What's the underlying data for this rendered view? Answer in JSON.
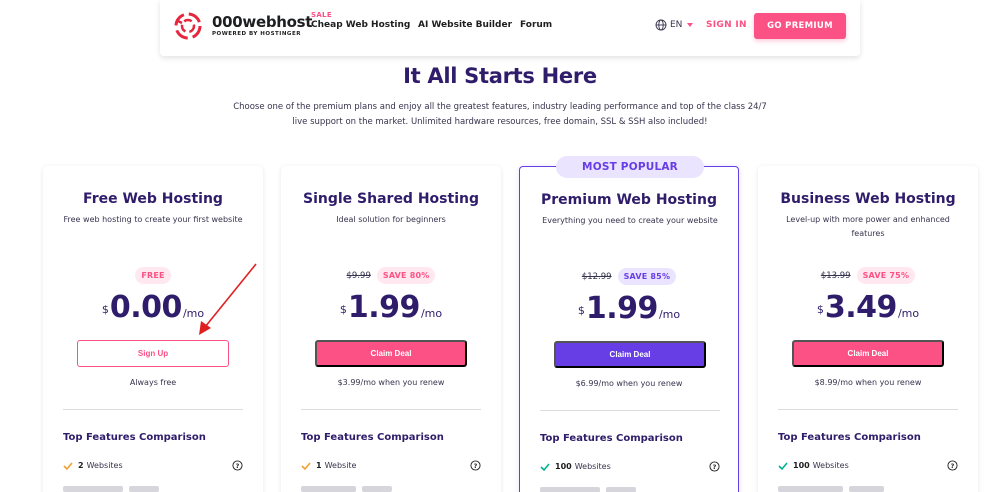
{
  "header": {
    "logo": {
      "name": "000webhost",
      "sub": "POWERED BY HOSTINGER"
    },
    "nav": [
      {
        "label": "Cheap Web Hosting",
        "tag": "SALE"
      },
      {
        "label": "AI Website Builder"
      },
      {
        "label": "Forum"
      }
    ],
    "language": "EN",
    "sign_in": "SIGN IN",
    "go_premium": "GO PREMIUM"
  },
  "hero": {
    "title": "It All Starts Here",
    "description": "Choose one of the premium plans and enjoy all the greatest features, industry leading performance and top of the class 24/7 live support on the market. Unlimited hardware resources, free domain, SSL & SSH also included!"
  },
  "plans": [
    {
      "title": "Free Web Hosting",
      "subtitle": "Free web hosting to create your first website",
      "old_price": "",
      "save": "FREE",
      "currency": "$",
      "price": "0.00",
      "period": "/mo",
      "cta": "Sign Up",
      "renew": "Always free",
      "features_title": "Top Features Comparison",
      "feature_count": "2",
      "feature_label": "Websites"
    },
    {
      "title": "Single Shared Hosting",
      "subtitle": "Ideal solution for beginners",
      "old_price": "$9.99",
      "save": "SAVE 80%",
      "currency": "$",
      "price": "1.99",
      "period": "/mo",
      "cta": "Claim Deal",
      "renew": "$3.99/mo when you renew",
      "features_title": "Top Features Comparison",
      "feature_count": "1",
      "feature_label": "Website"
    },
    {
      "badge": "MOST POPULAR",
      "title": "Premium Web Hosting",
      "subtitle": "Everything you need to create your website",
      "old_price": "$12.99",
      "save": "SAVE 85%",
      "currency": "$",
      "price": "1.99",
      "period": "/mo",
      "cta": "Claim Deal",
      "renew": "$6.99/mo when you renew",
      "features_title": "Top Features Comparison",
      "feature_count": "100",
      "feature_label": "Websites"
    },
    {
      "title": "Business Web Hosting",
      "subtitle": "Level-up with more power and enhanced features",
      "old_price": "$13.99",
      "save": "SAVE 75%",
      "currency": "$",
      "price": "3.49",
      "period": "/mo",
      "cta": "Claim Deal",
      "renew": "$8.99/mo when you renew",
      "features_title": "Top Features Comparison",
      "feature_count": "100",
      "feature_label": "Websites"
    }
  ],
  "colors": {
    "brand_pink": "#fc5185",
    "brand_purple": "#673de6",
    "title_navy": "#2f1c6a",
    "check_orange": "#f0a030",
    "check_green": "#00b090",
    "annotation_red": "#e02020"
  },
  "icons": [
    "globe-icon",
    "caret-down-icon",
    "check-icon",
    "help-circle-icon",
    "annotation-arrow"
  ]
}
